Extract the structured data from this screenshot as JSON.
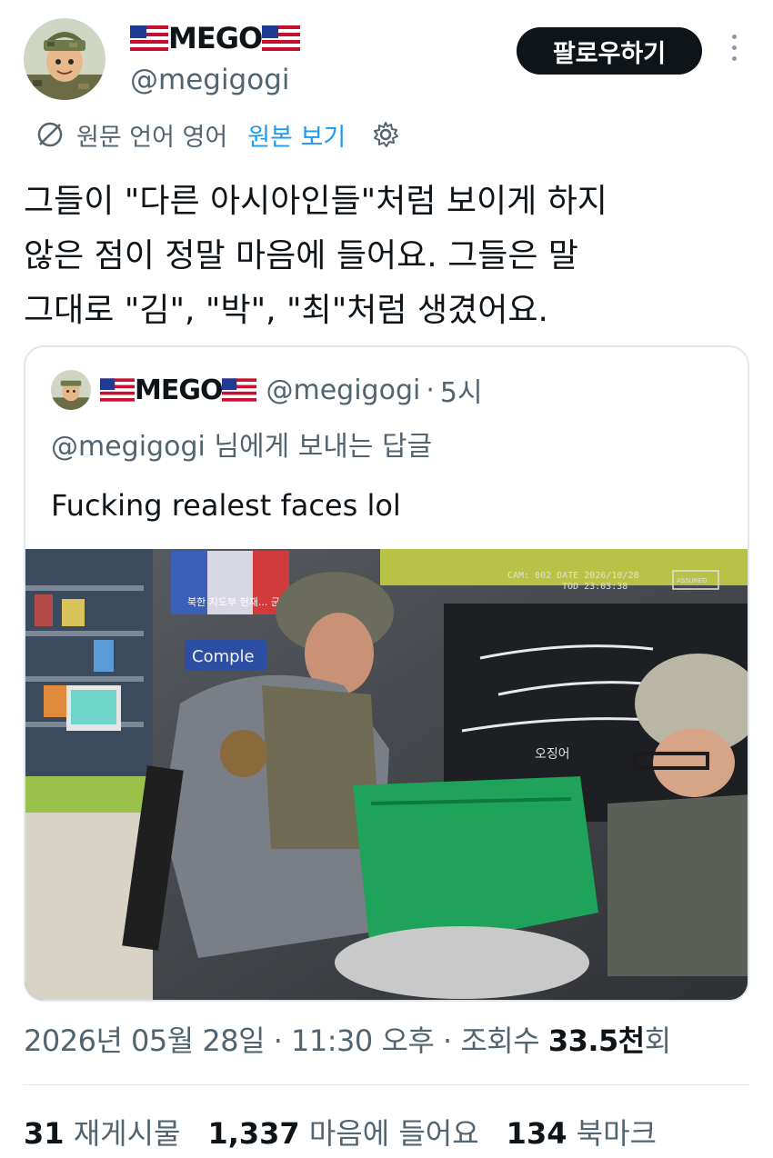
{
  "header": {
    "display_name": "MEGO",
    "handle": "@megigogi",
    "follow_label": "팔로우하기",
    "avatar_icon": "soldier-avatar-icon"
  },
  "translation": {
    "source_label": "원문 언어 영어",
    "show_original_label": "원본 보기"
  },
  "tweet": {
    "lines": [
      "그들이 \"다른 아시아인들\"처럼 보이게 하지",
      "않은 점이 정말 마음에 들어요. 그들은 말",
      "그대로 \"김\", \"박\", \"최\"처럼 생겼어요."
    ]
  },
  "quote": {
    "display_name": "MEGO",
    "handle": "@megigogi",
    "separator": "·",
    "time": "5시",
    "reply_to": "@megigogi 님에게 보내는 답글",
    "text": "Fucking realest faces lol",
    "media": {
      "cam_line1": "CAM: 002  DATE 2026/10/28",
      "cam_line2": "TOD  23:03:38",
      "badge": "ASSURED",
      "store_sign": "Comple",
      "poster_text": "북한 지도부 현재... 군사",
      "shirt_text": "오징어"
    }
  },
  "meta": {
    "datetime": "2026년 05월 28일 · 11:30 오후 · 조회수 ",
    "views_value": "33.5천",
    "views_suffix": "회"
  },
  "stats": {
    "retweets_count": "31",
    "retweets_label": "재게시물",
    "likes_count": "1,337",
    "likes_label": "마음에 들어요",
    "bookmarks_count": "134",
    "bookmarks_label": "북마크"
  },
  "colors": {
    "accent": "#1d9bf0",
    "secondary_text": "#536471",
    "primary_text": "#0f1419"
  }
}
